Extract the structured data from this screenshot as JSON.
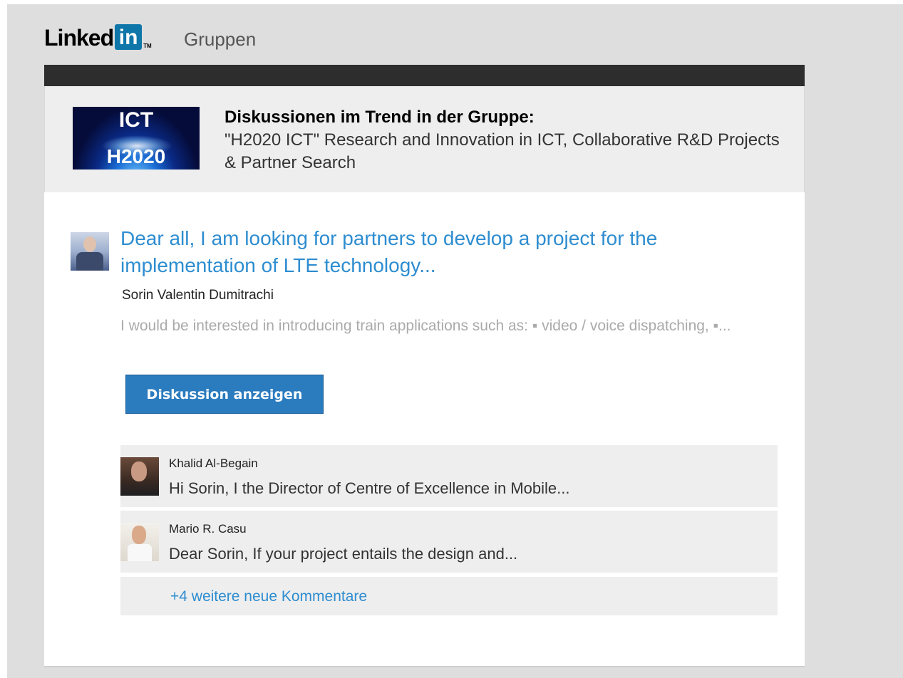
{
  "brand": {
    "logo_text": "Linked",
    "logo_in": "in",
    "logo_tm": "TM",
    "section": "Gruppen",
    "accent_color": "#0e76a8"
  },
  "group": {
    "logo_top_text": "ICT",
    "logo_bottom_text": "H2020",
    "label": "Diskussionen im Trend in der Gruppe:",
    "name": "\"H2020 ICT\" Research and Innovation in ICT, Collaborative R&D Projects & Partner Search"
  },
  "post": {
    "title": "Dear all, I am looking for partners to develop a project for the implementation of LTE technology...",
    "author": "Sorin Valentin Dumitrachi",
    "snippet": "I would be interested in introducing train applications such as: ▪ video / voice dispatching, ▪...",
    "cta_label": "Diskussion anzeigen",
    "link_color": "#2e8dd0",
    "button_color": "#2b7bbf"
  },
  "comments": [
    {
      "author": "Khalid Al-Begain",
      "text": "Hi Sorin, I the Director of Centre of Excellence in Mobile..."
    },
    {
      "author": "Mario R. Casu",
      "text": "Dear Sorin, If your project entails the design and..."
    }
  ],
  "more_comments_label": "+4 weitere neue Kommentare"
}
